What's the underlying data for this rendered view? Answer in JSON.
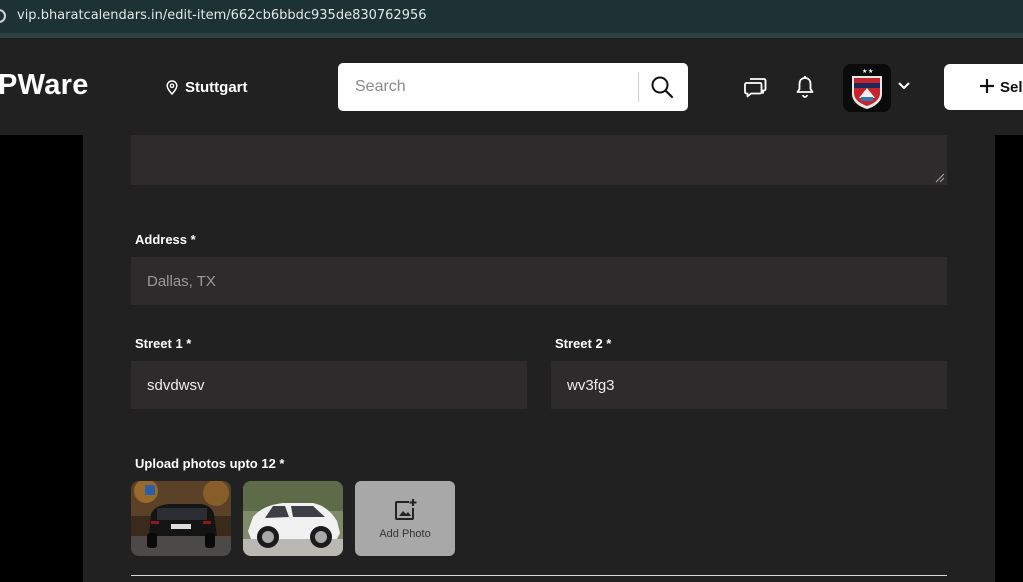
{
  "browser": {
    "url": "vip.bharatcalendars.in/edit-item/662cb6bbdc935de830762956"
  },
  "header": {
    "logo": "PWare",
    "location": "Stuttgart",
    "search_placeholder": "Search",
    "sell_label": "Sell"
  },
  "form": {
    "address_label": "Address *",
    "address_placeholder": "Dallas, TX",
    "street1_label": "Street 1 *",
    "street1_value": "sdvdwsv",
    "street2_label": "Street 2 *",
    "street2_value": "wv3fg3",
    "upload_label": "Upload photos upto 12 *",
    "add_photo_label": "Add Photo"
  },
  "icons": [
    "site-info-icon",
    "location-pin-icon",
    "search-icon",
    "chat-icon",
    "bell-icon",
    "chevron-down-icon",
    "plus-icon",
    "add-photo-icon"
  ],
  "colors": {
    "header_bg": "#212121",
    "panel_bg": "#212121",
    "field_bg": "#2d2b2c",
    "urlbar_bg": "#1d3232"
  }
}
